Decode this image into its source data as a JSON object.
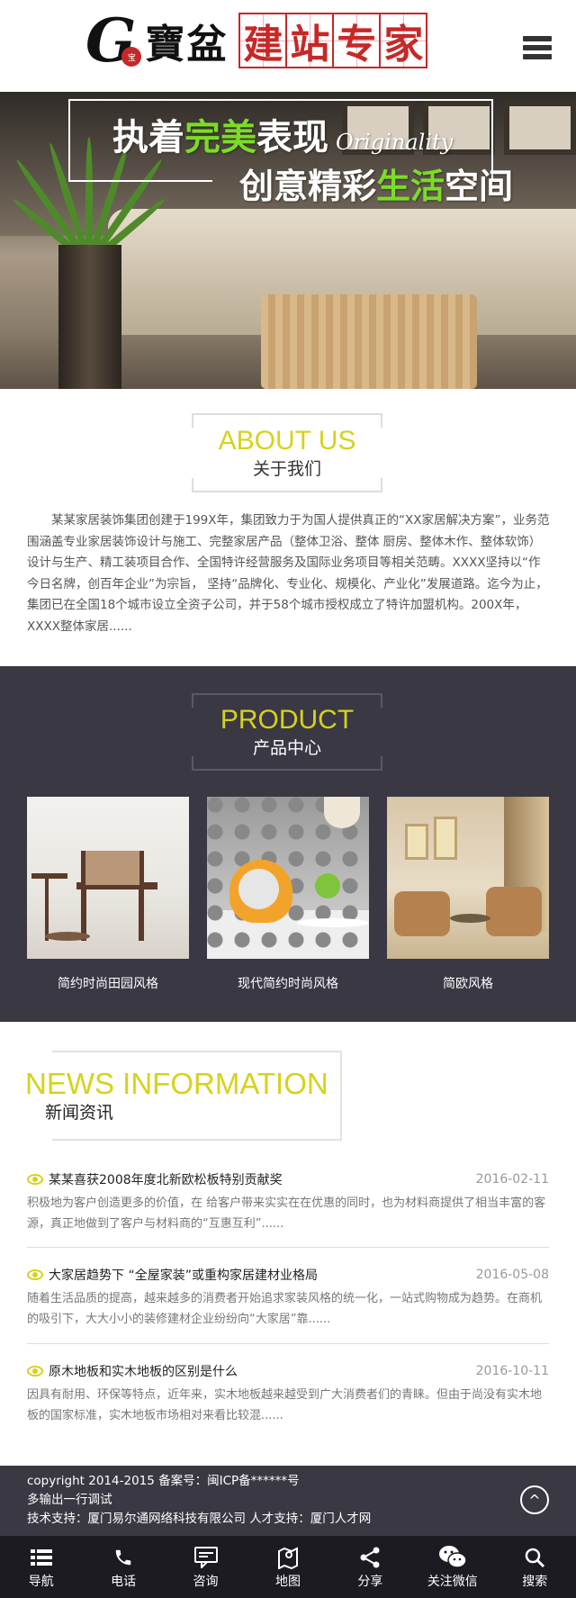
{
  "header": {
    "logo_letter": "G",
    "logo_seal": "宝",
    "logo_brand": "寶盆",
    "logo_boxes": [
      "建",
      "站",
      "专",
      "家"
    ]
  },
  "banner": {
    "line1_part1": "执着",
    "line1_highlight": "完美",
    "line1_part2": "表现",
    "line1_english": "Originality",
    "line2_part1": "创意精彩",
    "line2_highlight": "生活",
    "line2_part2": "空间",
    "highlight_color": "#7cdc28"
  },
  "about": {
    "title_en": "ABOUT US",
    "title_cn": "关于我们",
    "text": "某某家居装饰集团创建于199X年，集团致力于为国人提供真正的“XX家居解决方案”，业务范围涵盖专业家居装饰设计与施工、完整家居产品（整体卫浴、整体 厨房、整体木作、整体软饰）设计与生产、精工装项目合作、全国特许经营服务及国际业务项目等相关范畴。XXXX坚持以“作今日名牌，创百年企业”为宗旨， 坚持“品牌化、专业化、规模化、产业化”发展道路。迄今为止，集团已在全国18个城市设立全资子公司，并于58个城市授权成立了特许加盟机构。200X年，XXXX整体家居......"
  },
  "product": {
    "title_en": "PRODUCT",
    "title_cn": "产品中心",
    "items": [
      {
        "label": "简约时尚田园风格"
      },
      {
        "label": "现代简约时尚风格"
      },
      {
        "label": "简欧风格"
      }
    ]
  },
  "news": {
    "title_en": "NEWS INFORMATION",
    "title_cn": "新闻资讯",
    "items": [
      {
        "title": "某某喜获2008年度北新欧松板特别贡献奖",
        "date": "2016-02-11",
        "summary": "积极地为客户创造更多的价值，在 给客户带来实实在在优惠的同时，也为材料商提供了相当丰富的客源，真正地做到了客户与材料商的“互惠互利”......"
      },
      {
        "title": "大家居趋势下 “全屋家装”或重构家居建材业格局",
        "date": "2016-05-08",
        "summary": "随着生活品质的提高，越来越多的消费者开始追求家装风格的统一化，一站式购物成为趋势。在商机的吸引下，大大小小的装修建材企业纷纷向“大家居”靠......"
      },
      {
        "title": "原木地板和实木地板的区别是什么",
        "date": "2016-10-11",
        "summary": "因具有耐用、环保等特点，近年来，实木地板越来越受到广大消费者们的青睐。但由于尚没有实木地板的国家标准，实木地板市场相对来看比较混......"
      }
    ]
  },
  "footer": {
    "line1": "copyright 2014-2015 备案号：闽ICP备******号",
    "line2": "多输出一行调试",
    "line3": "技术支持：厦门易尔通网络科技有限公司 人才支持：厦门人才网",
    "to_top": "^"
  },
  "bottom_nav": [
    {
      "label": "导航",
      "icon": "list-icon"
    },
    {
      "label": "电话",
      "icon": "phone-icon"
    },
    {
      "label": "咨询",
      "icon": "chat-icon"
    },
    {
      "label": "地图",
      "icon": "map-icon"
    },
    {
      "label": "分享",
      "icon": "share-icon"
    },
    {
      "label": "关注微信",
      "icon": "wechat-icon"
    },
    {
      "label": "搜索",
      "icon": "search-icon"
    }
  ]
}
